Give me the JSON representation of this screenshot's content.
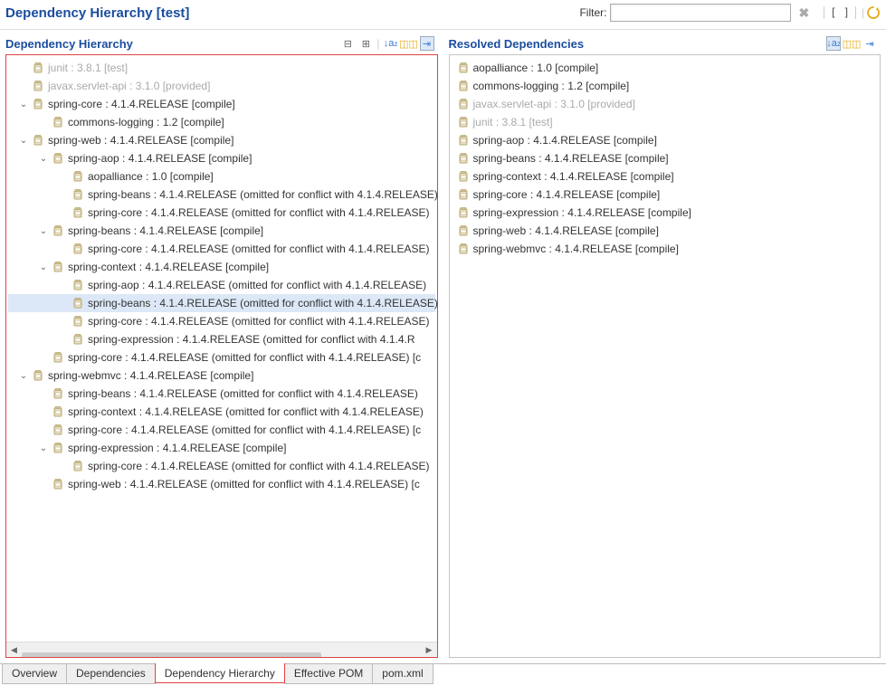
{
  "header": {
    "title": "Dependency Hierarchy [test]",
    "filter_label": "Filter:",
    "filter_value": ""
  },
  "left_panel": {
    "title": "Dependency Hierarchy",
    "tree": [
      {
        "depth": 0,
        "expand": "",
        "dim": true,
        "label": "junit : 3.8.1 [test]"
      },
      {
        "depth": 0,
        "expand": "",
        "dim": true,
        "label": "javax.servlet-api : 3.1.0 [provided]"
      },
      {
        "depth": 0,
        "expand": "v",
        "dim": false,
        "label": "spring-core : 4.1.4.RELEASE [compile]"
      },
      {
        "depth": 1,
        "expand": "",
        "dim": false,
        "label": "commons-logging : 1.2 [compile]"
      },
      {
        "depth": 0,
        "expand": "v",
        "dim": false,
        "label": "spring-web : 4.1.4.RELEASE [compile]"
      },
      {
        "depth": 1,
        "expand": "v",
        "dim": false,
        "label": "spring-aop : 4.1.4.RELEASE [compile]"
      },
      {
        "depth": 2,
        "expand": "",
        "dim": false,
        "label": "aopalliance : 1.0 [compile]"
      },
      {
        "depth": 2,
        "expand": "",
        "dim": false,
        "label": "spring-beans : 4.1.4.RELEASE (omitted for conflict with 4.1.4.RELEASE)"
      },
      {
        "depth": 2,
        "expand": "",
        "dim": false,
        "label": "spring-core : 4.1.4.RELEASE (omitted for conflict with 4.1.4.RELEASE)"
      },
      {
        "depth": 1,
        "expand": "v",
        "dim": false,
        "label": "spring-beans : 4.1.4.RELEASE [compile]"
      },
      {
        "depth": 2,
        "expand": "",
        "dim": false,
        "label": "spring-core : 4.1.4.RELEASE (omitted for conflict with 4.1.4.RELEASE)"
      },
      {
        "depth": 1,
        "expand": "v",
        "dim": false,
        "label": "spring-context : 4.1.4.RELEASE [compile]"
      },
      {
        "depth": 2,
        "expand": "",
        "dim": false,
        "label": "spring-aop : 4.1.4.RELEASE (omitted for conflict with 4.1.4.RELEASE)"
      },
      {
        "depth": 2,
        "expand": "",
        "dim": false,
        "selected": true,
        "label": "spring-beans : 4.1.4.RELEASE (omitted for conflict with 4.1.4.RELEASE)"
      },
      {
        "depth": 2,
        "expand": "",
        "dim": false,
        "label": "spring-core : 4.1.4.RELEASE (omitted for conflict with 4.1.4.RELEASE)"
      },
      {
        "depth": 2,
        "expand": "",
        "dim": false,
        "label": "spring-expression : 4.1.4.RELEASE (omitted for conflict with 4.1.4.R"
      },
      {
        "depth": 1,
        "expand": "",
        "dim": false,
        "label": "spring-core : 4.1.4.RELEASE (omitted for conflict with 4.1.4.RELEASE) [c"
      },
      {
        "depth": 0,
        "expand": "v",
        "dim": false,
        "label": "spring-webmvc : 4.1.4.RELEASE [compile]"
      },
      {
        "depth": 1,
        "expand": "",
        "dim": false,
        "label": "spring-beans : 4.1.4.RELEASE (omitted for conflict with 4.1.4.RELEASE)"
      },
      {
        "depth": 1,
        "expand": "",
        "dim": false,
        "label": "spring-context : 4.1.4.RELEASE (omitted for conflict with 4.1.4.RELEASE)"
      },
      {
        "depth": 1,
        "expand": "",
        "dim": false,
        "label": "spring-core : 4.1.4.RELEASE (omitted for conflict with 4.1.4.RELEASE) [c"
      },
      {
        "depth": 1,
        "expand": "v",
        "dim": false,
        "label": "spring-expression : 4.1.4.RELEASE [compile]"
      },
      {
        "depth": 2,
        "expand": "",
        "dim": false,
        "label": "spring-core : 4.1.4.RELEASE (omitted for conflict with 4.1.4.RELEASE)"
      },
      {
        "depth": 1,
        "expand": "",
        "dim": false,
        "label": "spring-web : 4.1.4.RELEASE (omitted for conflict with 4.1.4.RELEASE) [c"
      }
    ]
  },
  "right_panel": {
    "title": "Resolved Dependencies",
    "list": [
      {
        "dim": false,
        "label": "aopalliance : 1.0 [compile]"
      },
      {
        "dim": false,
        "label": "commons-logging : 1.2 [compile]"
      },
      {
        "dim": true,
        "label": "javax.servlet-api : 3.1.0 [provided]"
      },
      {
        "dim": true,
        "label": "junit : 3.8.1 [test]"
      },
      {
        "dim": false,
        "label": "spring-aop : 4.1.4.RELEASE [compile]"
      },
      {
        "dim": false,
        "label": "spring-beans : 4.1.4.RELEASE [compile]"
      },
      {
        "dim": false,
        "label": "spring-context : 4.1.4.RELEASE [compile]"
      },
      {
        "dim": false,
        "label": "spring-core : 4.1.4.RELEASE [compile]"
      },
      {
        "dim": false,
        "label": "spring-expression : 4.1.4.RELEASE [compile]"
      },
      {
        "dim": false,
        "label": "spring-web : 4.1.4.RELEASE [compile]"
      },
      {
        "dim": false,
        "label": "spring-webmvc : 4.1.4.RELEASE [compile]"
      }
    ]
  },
  "tabs": [
    {
      "label": "Overview",
      "active": false
    },
    {
      "label": "Dependencies",
      "active": false
    },
    {
      "label": "Dependency Hierarchy",
      "active": true
    },
    {
      "label": "Effective POM",
      "active": false
    },
    {
      "label": "pom.xml",
      "active": false
    }
  ]
}
